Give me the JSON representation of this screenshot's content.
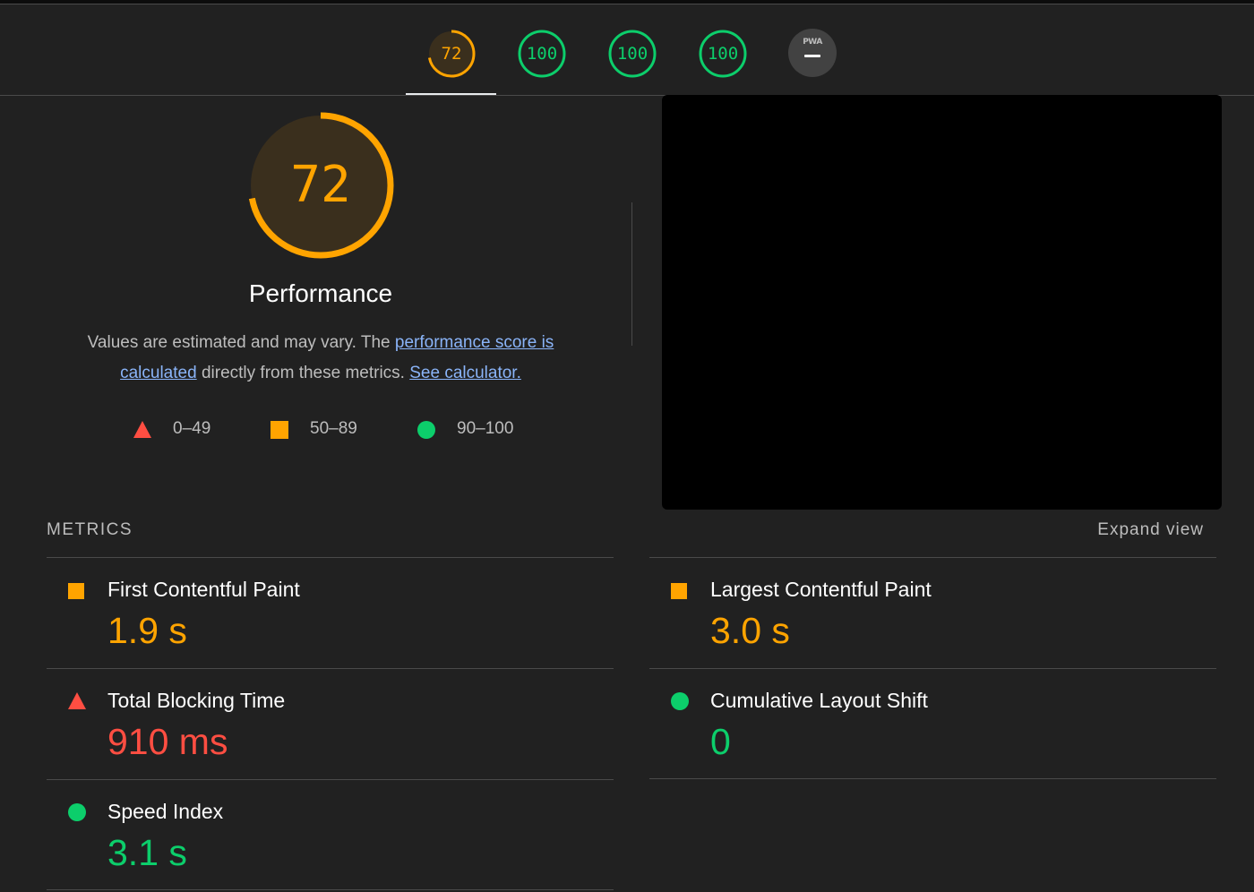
{
  "gauges": [
    {
      "name": "performance",
      "score": "72",
      "fraction": 0.72,
      "color": "#ffa400"
    },
    {
      "name": "accessibility",
      "score": "100",
      "fraction": 1.0,
      "color": "#0cce6b"
    },
    {
      "name": "best-practices",
      "score": "100",
      "fraction": 1.0,
      "color": "#0cce6b"
    },
    {
      "name": "seo",
      "score": "100",
      "fraction": 1.0,
      "color": "#0cce6b"
    }
  ],
  "pwa": {
    "label": "PWA"
  },
  "category": {
    "score": "72",
    "fraction": 0.72,
    "title": "Performance",
    "desc_prefix": "Values are estimated and may vary. The ",
    "link_score": "performance score is calculated",
    "desc_middle": " directly from these metrics. ",
    "link_calculator": "See calculator."
  },
  "legend": [
    {
      "shape": "triangle",
      "range": "0–49",
      "color": "#ff4e42"
    },
    {
      "shape": "square",
      "range": "50–89",
      "color": "#ffa400"
    },
    {
      "shape": "circle",
      "range": "90–100",
      "color": "#0cce6b"
    }
  ],
  "metrics": {
    "heading": "METRICS",
    "expand_label": "Expand view",
    "fcp": {
      "label": "First Contentful Paint",
      "value": "1.9 s",
      "rating": "average"
    },
    "tbt": {
      "label": "Total Blocking Time",
      "value": "910 ms",
      "rating": "fail"
    },
    "si": {
      "label": "Speed Index",
      "value": "3.1 s",
      "rating": "pass"
    },
    "lcp": {
      "label": "Largest Contentful Paint",
      "value": "3.0 s",
      "rating": "average"
    },
    "cls": {
      "label": "Cumulative Layout Shift",
      "value": "0",
      "rating": "pass"
    }
  }
}
